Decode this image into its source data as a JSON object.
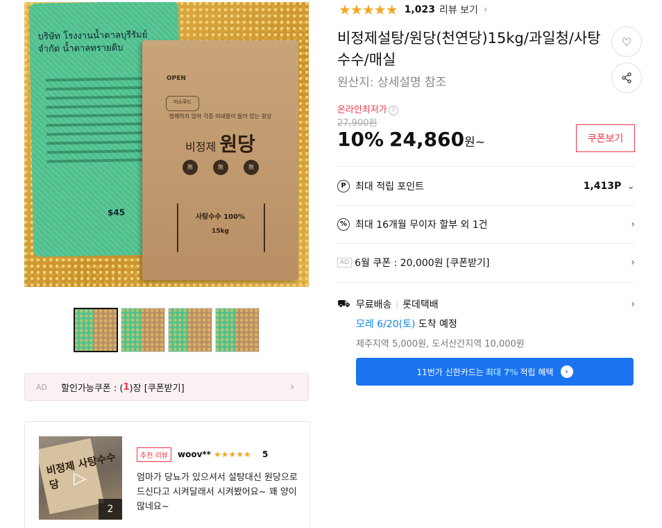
{
  "product": {
    "title": "비정제설탕/원당(천연당)15kg/과일청/사탕수수/매실",
    "origin": "원산지:  상세설명 참조",
    "rating_stars": "★★★★★",
    "review_count": "1,023",
    "review_link": "리뷰 보기"
  },
  "bag_art": {
    "thai_title": "บริษัท โรงงานน้ำตาลบุรีรัมย์ จำกัด น้ำตาลทรายดิบ",
    "net_code": "$45",
    "open_logo": "OPEN",
    "brand_badge": "미소푸드",
    "sub_line": "정제하지 않아 각종 미네랄이 들어 있는 원당",
    "name_small": "비정제",
    "name_large": "원당",
    "dot1": "無",
    "dot2": "無",
    "dot3": "無",
    "pct_text": "사탕수수 100%",
    "weight": "15kg"
  },
  "price": {
    "lowest_label": "온라인최저가",
    "help_icon": "?",
    "original": "27,900원",
    "discount": "10%",
    "sale": "24,860",
    "unit": "원~",
    "coupon_button": "쿠폰보기"
  },
  "points": {
    "icon": "P",
    "label": "최대 적립 포인트",
    "value": "1,413P"
  },
  "installment": {
    "icon": "%",
    "label": "최대 16개월 무이자 할부 외 1건"
  },
  "ad_coupon_row": {
    "tag": "AD",
    "label": "6월 쿠폰 : 20,000원 [쿠폰받기]"
  },
  "shipping": {
    "label": "무료배송",
    "carrier": "롯데택배",
    "eta_date": "모레 6/20(토)",
    "eta_suffix": " 도착 예정",
    "extra": "제주지역 5,000원, 도서산간지역 10,000원"
  },
  "card_banner": {
    "prefix": "11번가 신한카드는",
    "highlight": "최대 7%",
    "suffix": "적립 혜택"
  },
  "left_coupon": {
    "tag": "AD",
    "text_prefix": "할인가능쿠폰 : (",
    "count": "1",
    "text_suffix": ")장 [쿠폰받기]"
  },
  "review": {
    "badge": "추천 리뷰",
    "author": "woov**",
    "stars": "★★★★★",
    "score": "5",
    "text": "엄마가 당뇨가 있으셔서 설탕대신 원당으로 드신다고 시켜달래서 시켜봤어요~ 꽤 양이 많네요~",
    "media_count": "2",
    "video_label": "비정제 사탕수수당"
  },
  "icons": {
    "heart": "♡",
    "share": "⋰",
    "chevron": "›",
    "chevron_down": "⌄",
    "play": "▷",
    "truck": "⛟",
    "go": "›"
  },
  "colors": {
    "accent_red": "#f43142",
    "star": "#f5a623",
    "blue": "#1c73f0",
    "eta_blue": "#0b83e6"
  }
}
